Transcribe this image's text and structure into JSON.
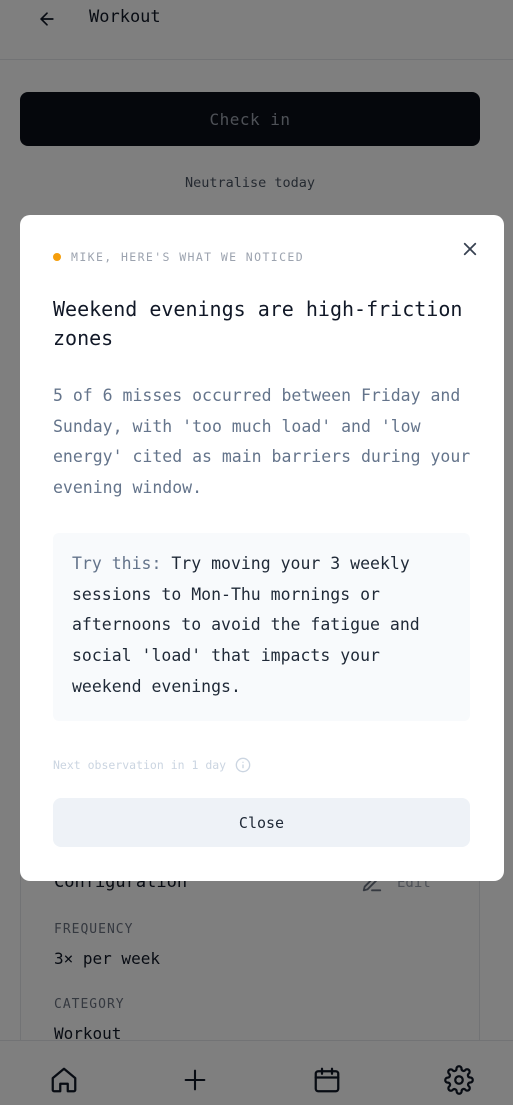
{
  "header": {
    "title": "Workout"
  },
  "actions": {
    "checkin_label": "Check in",
    "neutralise_label": "Neutralise today"
  },
  "config": {
    "title": "Configuration",
    "edit_label": "Edit",
    "frequency_label": "FREQUENCY",
    "frequency_value": "3× per week",
    "category_label": "CATEGORY",
    "category_value": "Workout"
  },
  "nav": {
    "items": [
      {
        "icon": "home-icon"
      },
      {
        "icon": "plus-icon"
      },
      {
        "icon": "calendar-icon"
      },
      {
        "icon": "gear-icon"
      }
    ]
  },
  "modal": {
    "eyebrow": "MIKE, HERE'S WHAT WE NOTICED",
    "eyebrow_color": "#f59e0b",
    "title": "Weekend evenings are high-friction zones",
    "body": "5 of 6 misses occurred between Friday and Sunday, with 'too much load' and 'low energy' cited as main barriers during your evening window.",
    "tip_label": "Try this:",
    "tip_text": " Try moving your 3 weekly sessions to Mon-Thu mornings or afternoons to avoid the fatigue and social 'load' that impacts your weekend evenings.",
    "next_observation": "Next observation in 1 day",
    "close_label": "Close"
  }
}
